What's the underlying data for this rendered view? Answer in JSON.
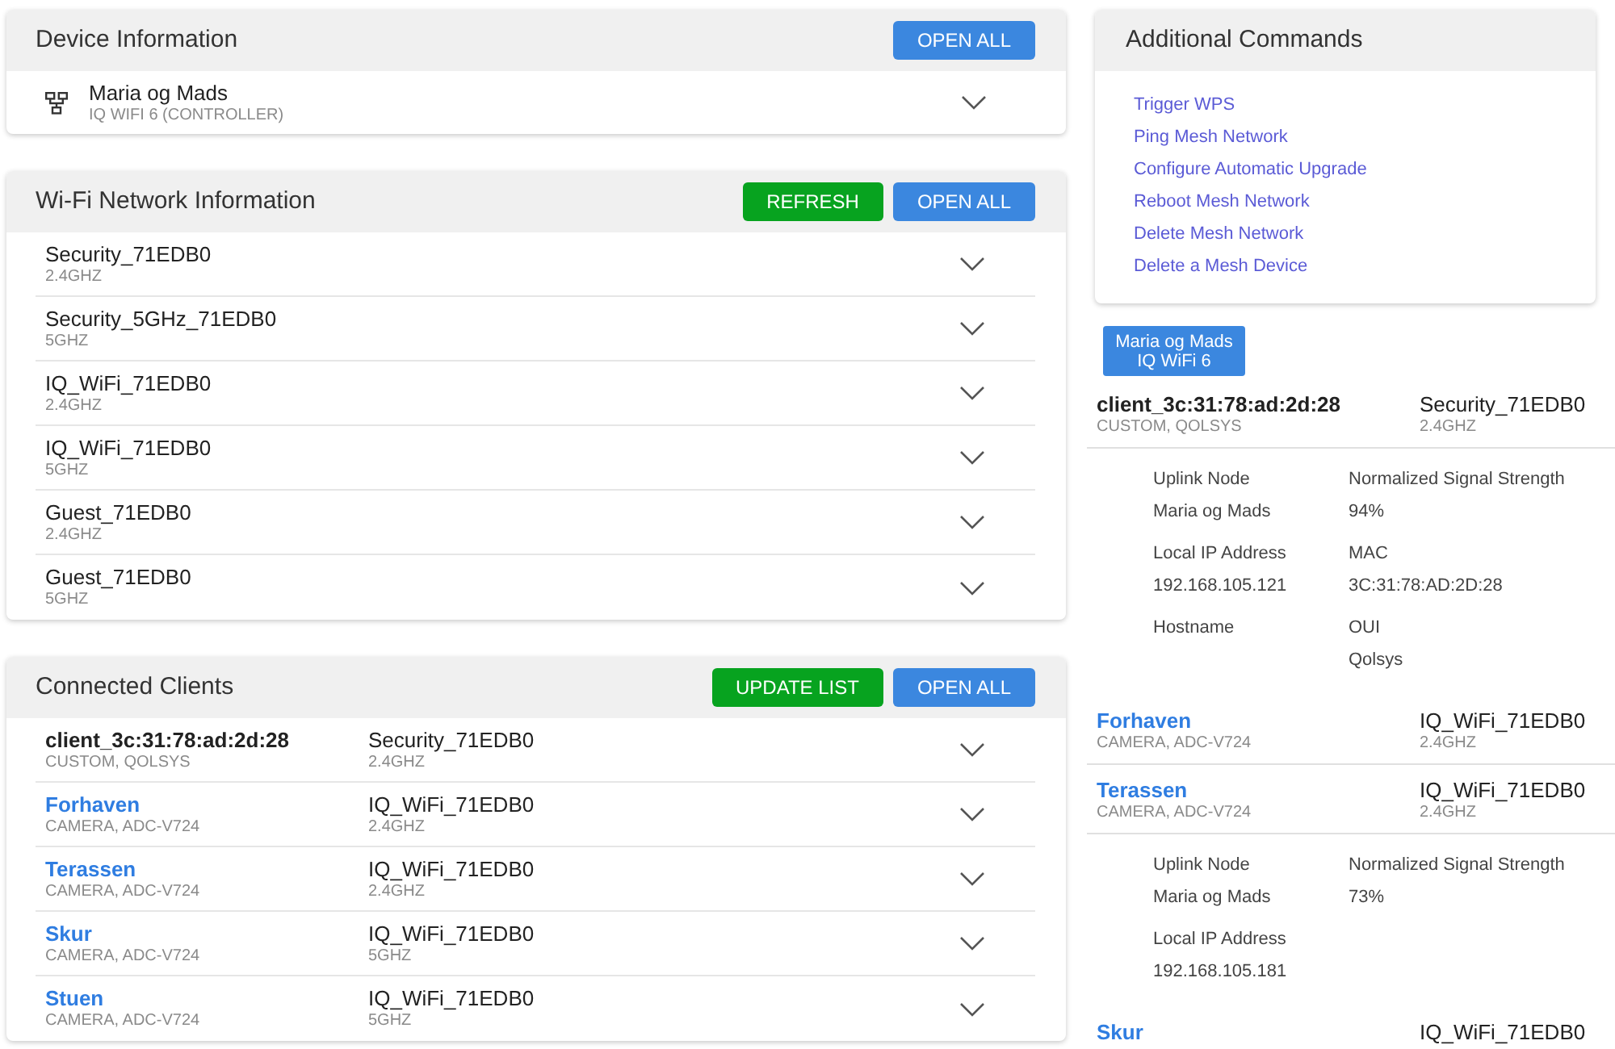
{
  "device_information": {
    "title": "Device Information",
    "buttons": [
      {
        "label": "OPEN ALL",
        "kind": "primary"
      }
    ],
    "devices": [
      {
        "name": "Maria og Mads",
        "model": "IQ WIFI 6 (CONTROLLER)",
        "expanded": false
      }
    ]
  },
  "wifi_network_information": {
    "title": "Wi-Fi Network Information",
    "buttons": [
      {
        "label": "REFRESH",
        "kind": "success"
      },
      {
        "label": "OPEN ALL",
        "kind": "primary"
      }
    ],
    "networks": [
      {
        "name": "Security_71EDB0",
        "band": "2.4GHZ",
        "expanded": false
      },
      {
        "name": "Security_5GHz_71EDB0",
        "band": "5GHZ",
        "expanded": false
      },
      {
        "name": "IQ_WiFi_71EDB0",
        "band": "2.4GHZ",
        "expanded": false
      },
      {
        "name": "IQ_WiFi_71EDB0",
        "band": "5GHZ",
        "expanded": false
      },
      {
        "name": "Guest_71EDB0",
        "band": "2.4GHZ",
        "expanded": false
      },
      {
        "name": "Guest_71EDB0",
        "band": "5GHZ",
        "expanded": false
      }
    ]
  },
  "connected_clients": {
    "title": "Connected Clients",
    "buttons": [
      {
        "label": "UPDATE LIST",
        "kind": "success"
      },
      {
        "label": "OPEN ALL",
        "kind": "primary"
      }
    ],
    "clients": [
      {
        "name": "client_3c:31:78:ad:2d:28",
        "link": false,
        "description": "CUSTOM, QOLSYS",
        "network": "Security_71EDB0",
        "band": "2.4GHZ",
        "expanded": false
      },
      {
        "name": "Forhaven",
        "link": true,
        "description": "CAMERA, ADC-V724",
        "network": "IQ_WiFi_71EDB0",
        "band": "2.4GHZ",
        "expanded": false
      },
      {
        "name": "Terassen",
        "link": true,
        "description": "CAMERA, ADC-V724",
        "network": "IQ_WiFi_71EDB0",
        "band": "2.4GHZ",
        "expanded": false
      },
      {
        "name": "Skur",
        "link": true,
        "description": "CAMERA, ADC-V724",
        "network": "IQ_WiFi_71EDB0",
        "band": "5GHZ",
        "expanded": false
      },
      {
        "name": "Stuen",
        "link": true,
        "description": "CAMERA, ADC-V724",
        "network": "IQ_WiFi_71EDB0",
        "band": "5GHZ",
        "expanded": false
      }
    ]
  },
  "additional_commands": {
    "title": "Additional Commands",
    "links": [
      "Trigger WPS",
      "Ping Mesh Network",
      "Configure Automatic Upgrade",
      "Reboot Mesh Network",
      "Delete Mesh Network",
      "Delete a Mesh Device"
    ]
  },
  "mesh_node": {
    "node_button": {
      "lines": [
        "Maria og Mads",
        "IQ WiFi 6"
      ]
    },
    "clients": [
      {
        "name": "client_3c:31:78:ad:2d:28",
        "link": false,
        "description": "CUSTOM, QOLSYS",
        "network": "Security_71EDB0",
        "band": "2.4GHZ",
        "details": [
          {
            "label": "Uplink Node",
            "value": "Maria og Mads"
          },
          {
            "label": "Normalized Signal Strength",
            "value": "94%"
          },
          {
            "label": "Local IP Address",
            "value": "192.168.105.121"
          },
          {
            "label": "MAC",
            "value": "3C:31:78:AD:2D:28"
          },
          {
            "label": "Hostname"
          },
          {
            "label": "OUI",
            "value": "Qolsys"
          }
        ]
      },
      {
        "name": "Forhaven",
        "link": true,
        "description": "CAMERA, ADC-V724",
        "network": "IQ_WiFi_71EDB0",
        "band": "2.4GHZ"
      },
      {
        "name": "Terassen",
        "link": true,
        "description": "CAMERA, ADC-V724",
        "network": "IQ_WiFi_71EDB0",
        "band": "2.4GHZ",
        "details": [
          {
            "label": "Uplink Node",
            "value": "Maria og Mads"
          },
          {
            "label": "Normalized Signal Strength",
            "value": "73%"
          },
          {
            "label": "Local IP Address",
            "value": "192.168.105.181"
          }
        ]
      },
      {
        "name": "Skur",
        "link": true,
        "network": "IQ_WiFi_71EDB0"
      }
    ]
  }
}
